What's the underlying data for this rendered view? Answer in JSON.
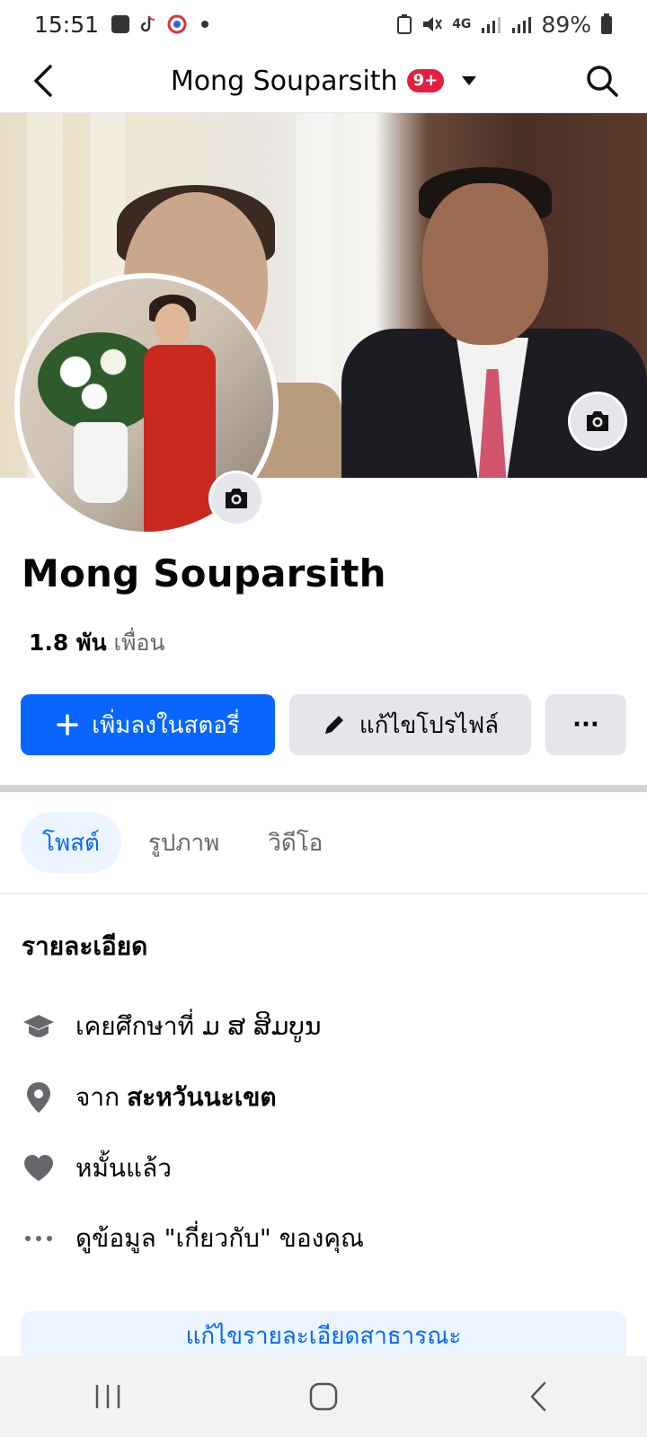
{
  "status_bar": {
    "time": "15:51",
    "battery": "89%",
    "network": "4G"
  },
  "header": {
    "title": "Mong Souparsith",
    "badge": "9+"
  },
  "profile": {
    "name": "Mong Souparsith",
    "friends_count": "1.8 พัน",
    "friends_label": "เพื่อน"
  },
  "actions": {
    "add_story": "เพิ่มลงในสตอรี่",
    "edit_profile": "แก้ไขโปรไฟล์",
    "more": "···"
  },
  "tabs": [
    {
      "label": "โพสต์",
      "active": true
    },
    {
      "label": "รูปภาพ",
      "active": false
    },
    {
      "label": "วิดีโอ",
      "active": false
    }
  ],
  "details": {
    "title": "รายละเอียด",
    "education": "เคยศึกษาที่ ມ ສ ສິມບູນ",
    "from_prefix": "จาก",
    "from_place": "สะหวันนะเขต",
    "relationship": "หมั้นแล้ว",
    "about": "ดูข้อมูล \"เกี่ยวกับ\" ของคุณ",
    "edit_public": "แก้ไขรายละเอียดสาธารณะ"
  },
  "icons": {
    "back": "back-arrow-icon",
    "search": "search-icon",
    "camera": "camera-icon",
    "plus": "plus-icon",
    "pencil": "pencil-icon",
    "education": "graduation-cap-icon",
    "location": "location-pin-icon",
    "heart": "heart-icon",
    "more": "more-dots-icon"
  },
  "colors": {
    "primary": "#0866ff",
    "badge": "#e41e3f",
    "secondary_button": "#e4e6eb",
    "tab_active_bg": "#ebf5ff"
  }
}
